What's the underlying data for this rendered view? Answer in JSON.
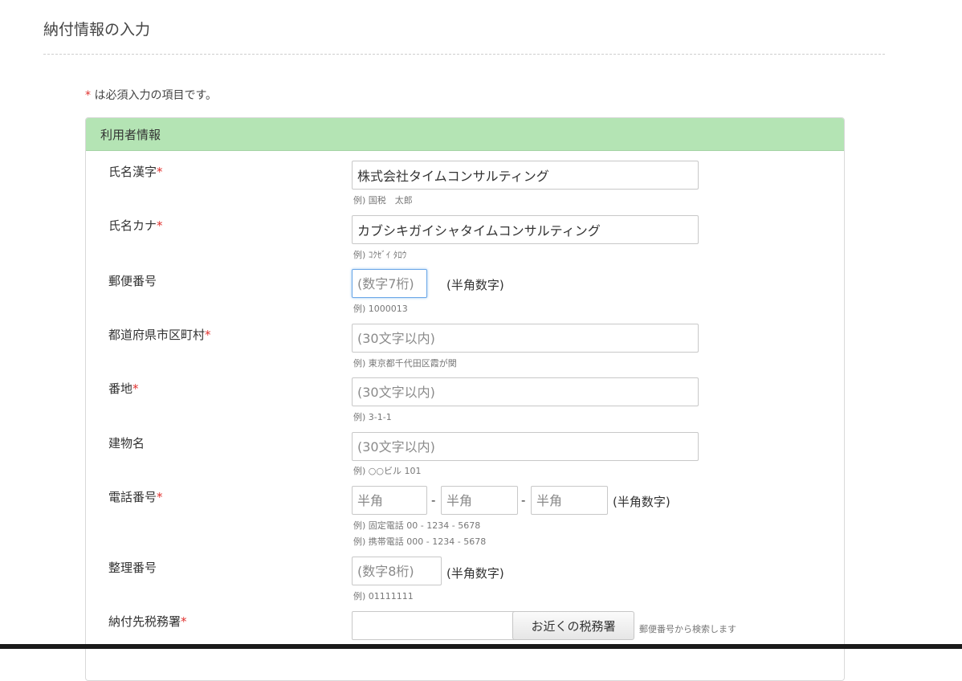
{
  "page": {
    "title": "納付情報の入力"
  },
  "required_note": {
    "marker": "*",
    "text": "は必須入力の項目です。"
  },
  "section": {
    "title": "利用者情報",
    "required_mark": "*",
    "fields": {
      "name_kanji": {
        "label": "氏名漢字",
        "value": "株式会社タイムコンサルティング",
        "hint": "例) 国税　太郎"
      },
      "name_kana": {
        "label": "氏名カナ",
        "value": "カブシキガイシャタイムコンサルティング",
        "hint": "例) ｺｸｾﾞｲ ﾀﾛｳ"
      },
      "postal": {
        "label": "郵便番号",
        "value": "",
        "placeholder": "(数字7桁)",
        "suffix": "(半角数字)",
        "hint": "例) 1000013"
      },
      "city": {
        "label": "都道府県市区町村",
        "value": "",
        "placeholder": "(30文字以内)",
        "hint": "例) 東京都千代田区霞が関"
      },
      "street": {
        "label": "番地",
        "value": "",
        "placeholder": "(30文字以内)",
        "hint": "例) 3-1-1"
      },
      "building": {
        "label": "建物名",
        "value": "",
        "placeholder": "(30文字以内)",
        "hint": "例) ○○ビル 101"
      },
      "phone": {
        "label": "電話番号",
        "placeholders": [
          "半角",
          "半角",
          "半角"
        ],
        "separator": "-",
        "suffix": "(半角数字)",
        "hint_landline": "例) 固定電話 00 - 1234 - 5678",
        "hint_mobile": "例) 携帯電話 000 - 1234 - 5678"
      },
      "reference": {
        "label": "整理番号",
        "value": "",
        "placeholder": "(数字8桁)",
        "suffix": "(半角数字)",
        "hint": "例) 01111111"
      },
      "tax_office": {
        "label": "納付先税務署",
        "value": "",
        "button": "お近くの税務署",
        "note": "郵便番号から検索します"
      }
    }
  }
}
